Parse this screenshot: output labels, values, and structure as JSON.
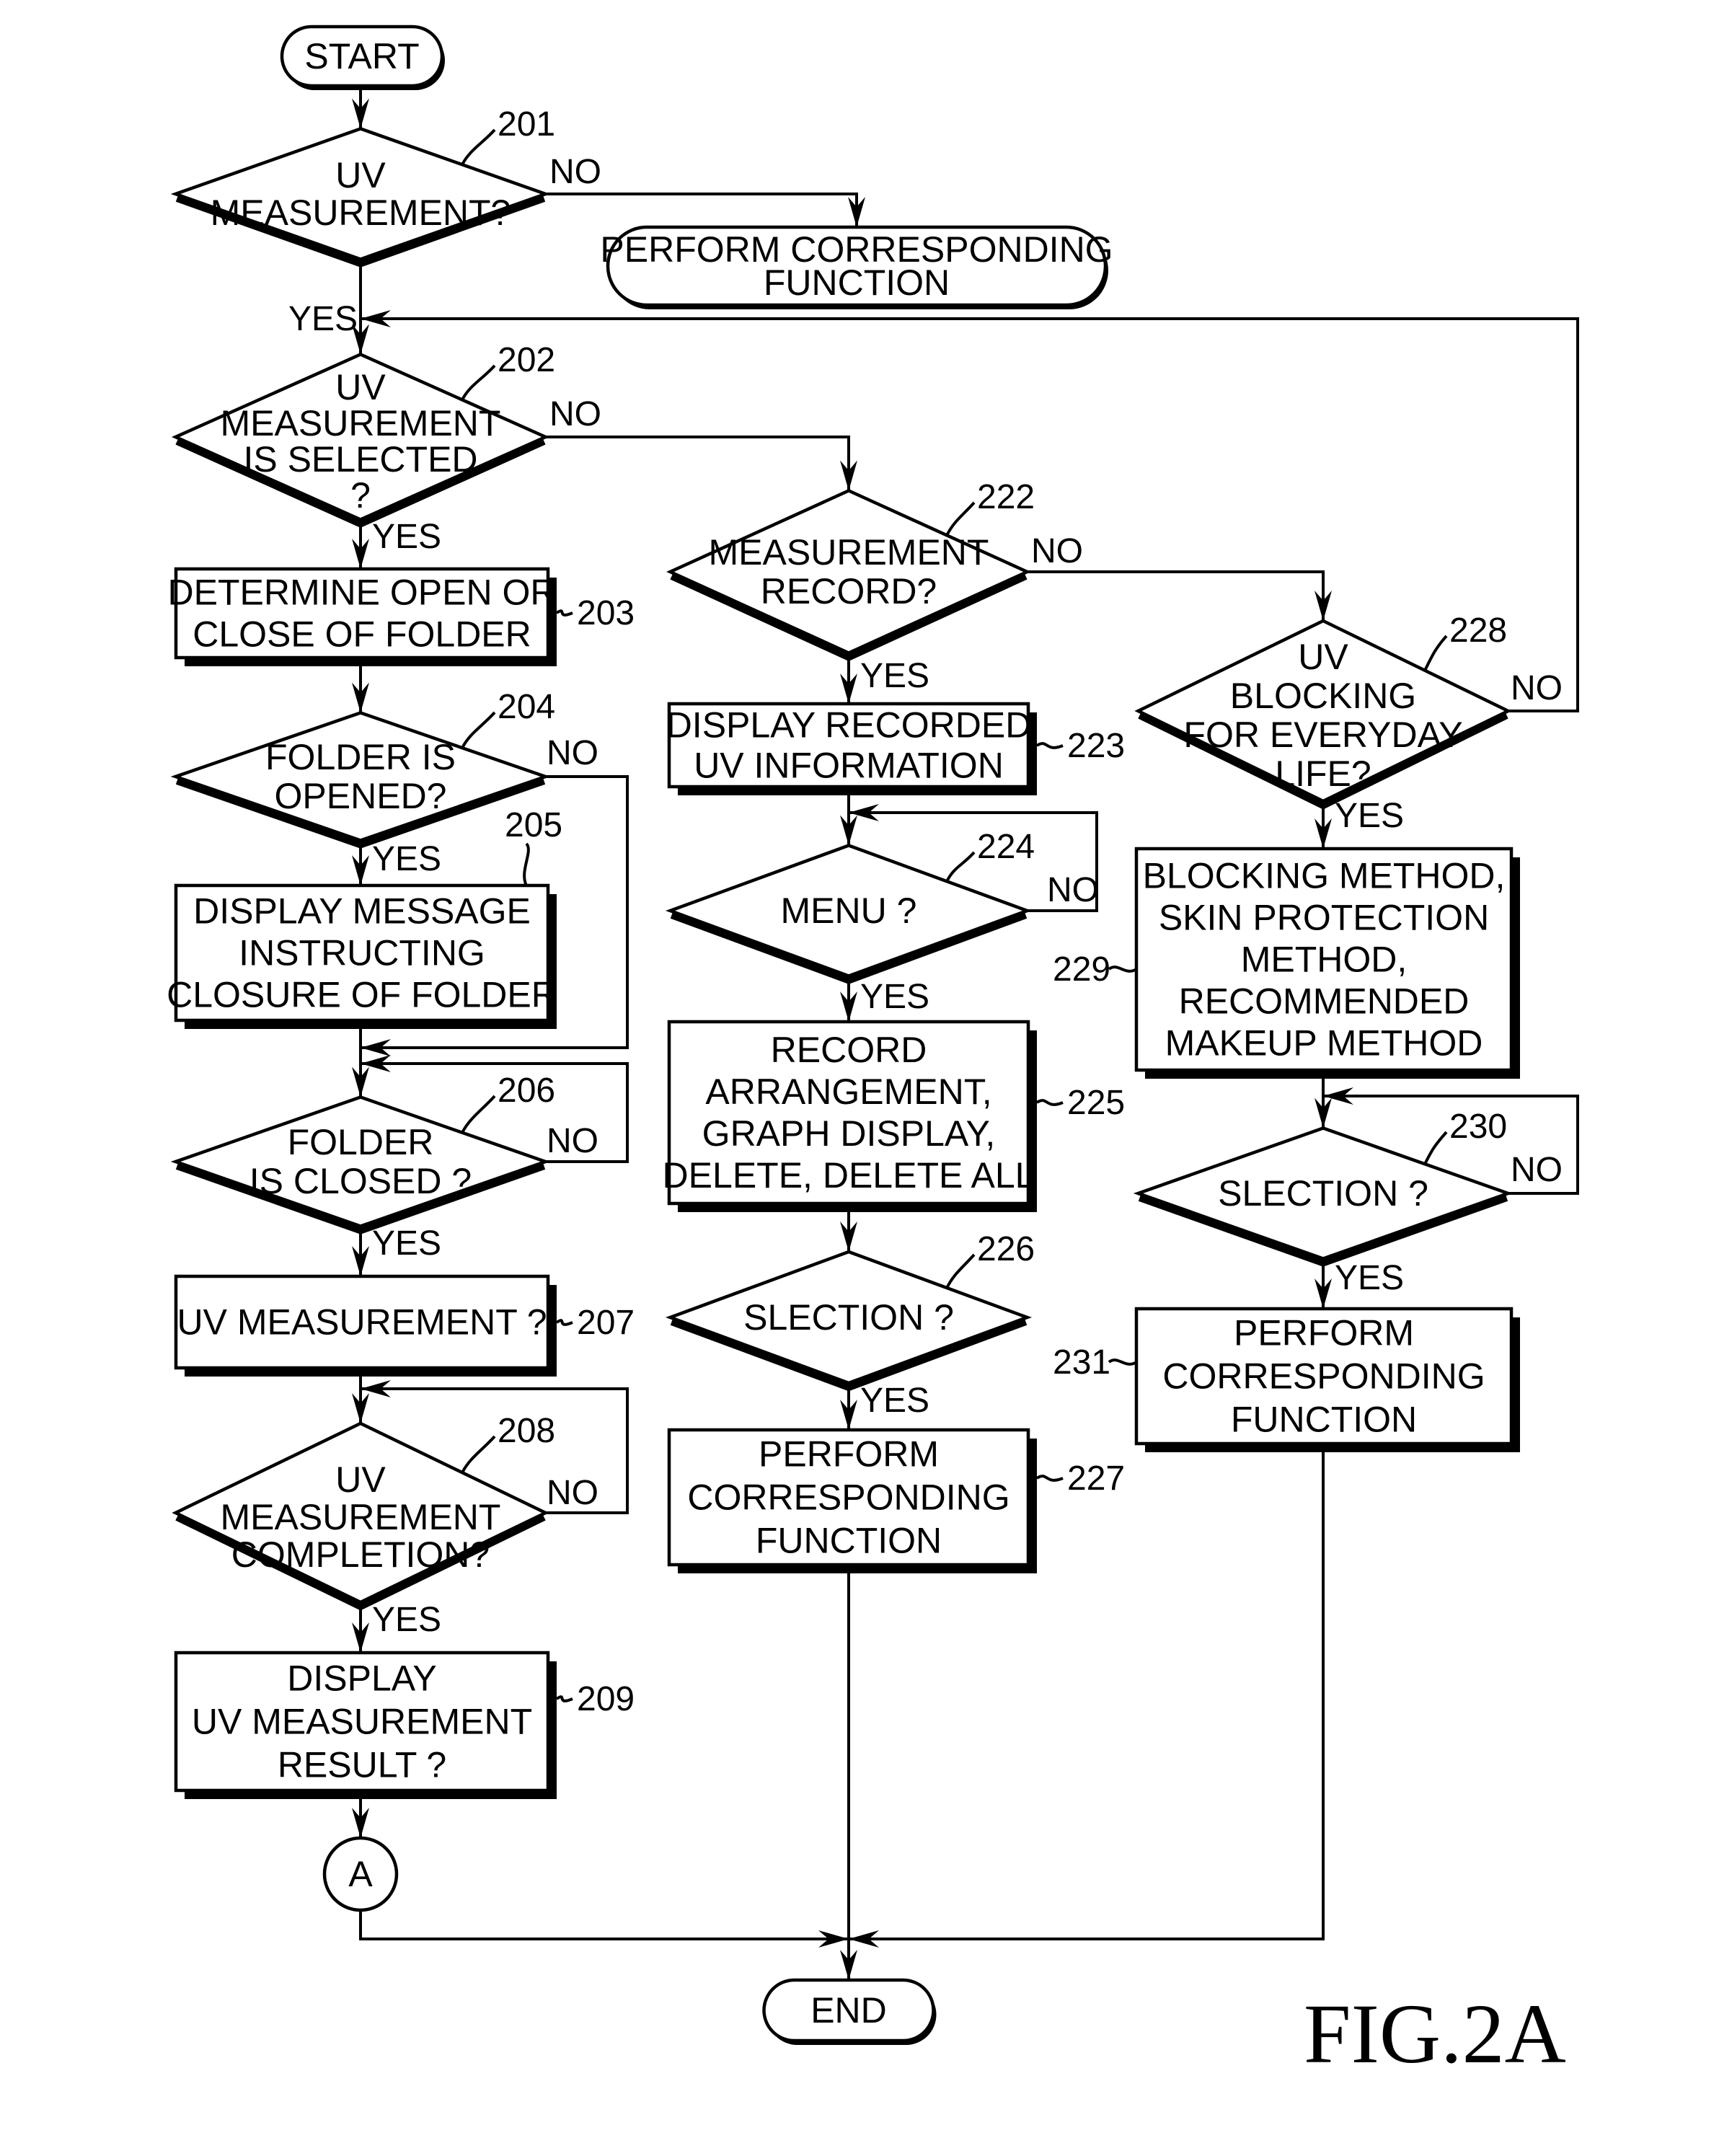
{
  "figure_label": "FIG.2A",
  "colors": {
    "ink": "#000000",
    "paper": "#ffffff"
  },
  "terminals": {
    "start": {
      "label": "START"
    },
    "end": {
      "label": "END"
    },
    "perform_top": {
      "lines": [
        "PERFORM CORRESPONDING",
        "FUNCTION"
      ]
    }
  },
  "connector": {
    "label": "A"
  },
  "branch_labels": {
    "yes": "YES",
    "no": "NO"
  },
  "nodes": {
    "201": {
      "ref": "201",
      "type": "decision",
      "lines": [
        "UV",
        "MEASUREMENT?"
      ]
    },
    "202": {
      "ref": "202",
      "type": "decision",
      "lines": [
        "UV",
        "MEASUREMENT",
        "IS SELECTED",
        "?"
      ]
    },
    "203": {
      "ref": "203",
      "type": "process",
      "lines": [
        "DETERMINE OPEN OR",
        "CLOSE OF FOLDER"
      ]
    },
    "204": {
      "ref": "204",
      "type": "decision",
      "lines": [
        "FOLDER IS",
        "OPENED?"
      ]
    },
    "205": {
      "ref": "205",
      "type": "process",
      "lines": [
        "DISPLAY MESSAGE",
        "INSTRUCTING",
        "CLOSURE OF FOLDER"
      ]
    },
    "206": {
      "ref": "206",
      "type": "decision",
      "lines": [
        "FOLDER",
        "IS CLOSED ?"
      ]
    },
    "207": {
      "ref": "207",
      "type": "process",
      "lines": [
        "UV MEASUREMENT ?"
      ]
    },
    "208": {
      "ref": "208",
      "type": "decision",
      "lines": [
        "UV",
        "MEASUREMENT",
        "COMPLETION?"
      ]
    },
    "209": {
      "ref": "209",
      "type": "process",
      "lines": [
        "DISPLAY",
        "UV MEASUREMENT",
        "RESULT ?"
      ]
    },
    "222": {
      "ref": "222",
      "type": "decision",
      "lines": [
        "MEASUREMENT",
        "RECORD?"
      ]
    },
    "223": {
      "ref": "223",
      "type": "process",
      "lines": [
        "DISPLAY RECORDED",
        "UV INFORMATION"
      ]
    },
    "224": {
      "ref": "224",
      "type": "decision",
      "lines": [
        "MENU ?"
      ]
    },
    "225": {
      "ref": "225",
      "type": "process",
      "lines": [
        "RECORD",
        "ARRANGEMENT,",
        "GRAPH DISPLAY,",
        "DELETE, DELETE ALL"
      ]
    },
    "226": {
      "ref": "226",
      "type": "decision",
      "lines": [
        "SLECTION ?"
      ]
    },
    "227": {
      "ref": "227",
      "type": "process",
      "lines": [
        "PERFORM",
        "CORRESPONDING",
        "FUNCTION"
      ]
    },
    "228": {
      "ref": "228",
      "type": "decision",
      "lines": [
        "UV",
        "BLOCKING",
        "FOR EVERYDAY",
        "LIFE?"
      ]
    },
    "229": {
      "ref": "229",
      "type": "process",
      "lines": [
        "BLOCKING METHOD,",
        "SKIN PROTECTION",
        "METHOD,",
        "RECOMMENDED",
        "MAKEUP METHOD"
      ]
    },
    "230": {
      "ref": "230",
      "type": "decision",
      "lines": [
        "SLECTION ?"
      ]
    },
    "231": {
      "ref": "231",
      "type": "process",
      "lines": [
        "PERFORM",
        "CORRESPONDING",
        "FUNCTION"
      ]
    }
  }
}
